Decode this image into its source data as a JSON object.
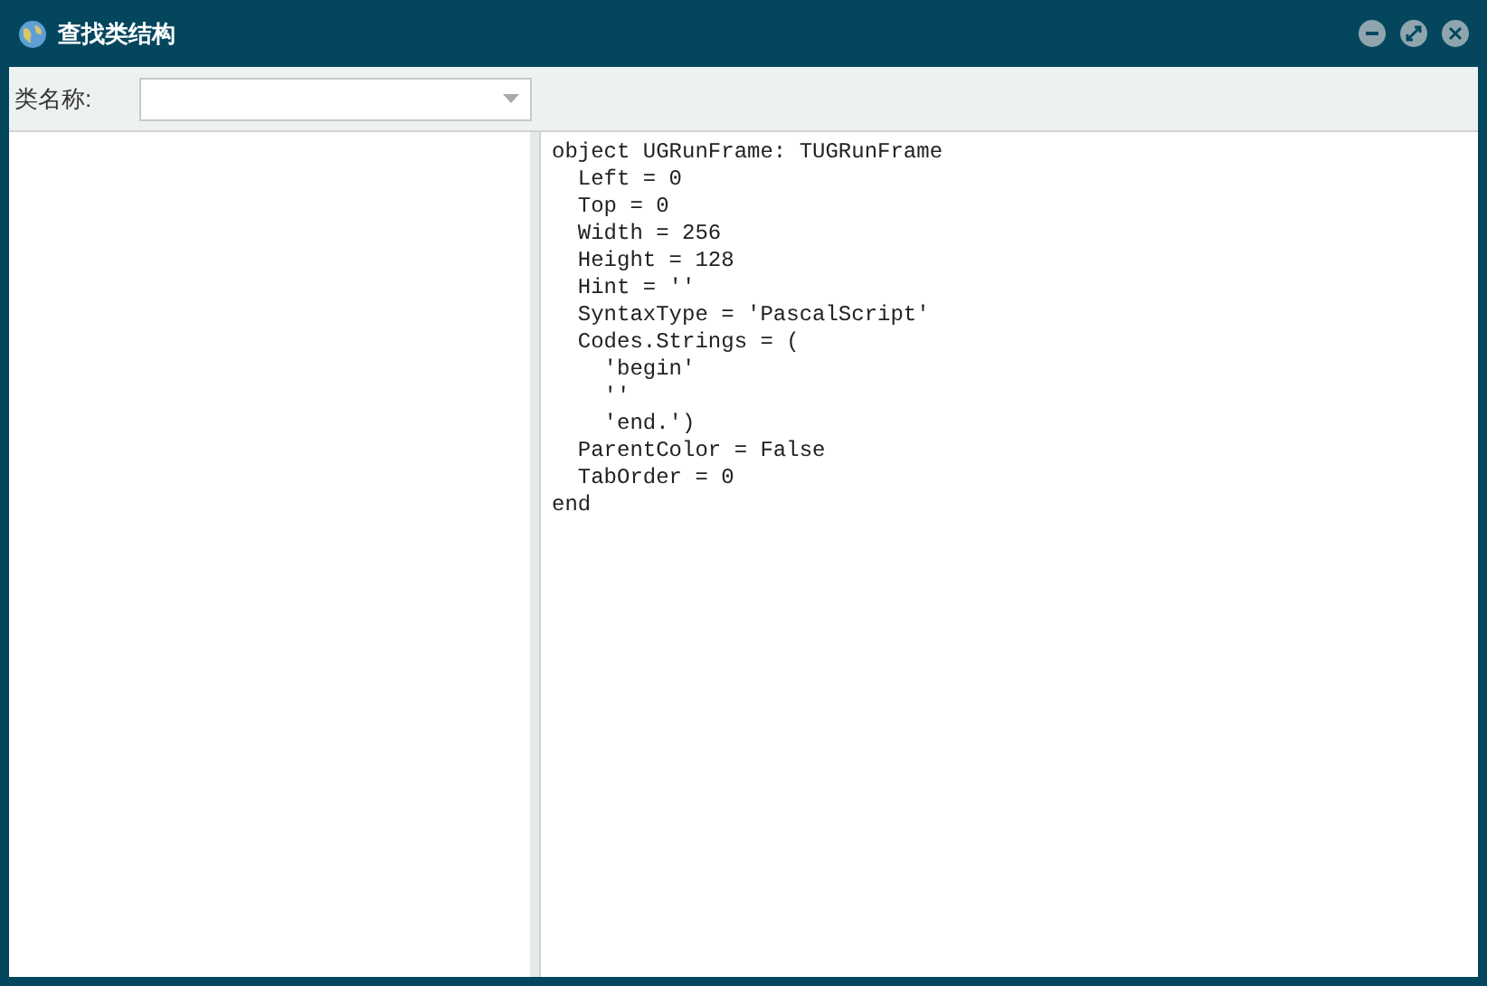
{
  "window": {
    "title": "查找类结构"
  },
  "class_name_field": {
    "label": "类名称:"
  },
  "code_lines": [
    "object UGRunFrame: TUGRunFrame",
    "  Left = 0",
    "  Top = 0",
    "  Width = 256",
    "  Height = 128",
    "  Hint = ''",
    "  SyntaxType = 'PascalScript'",
    "  Codes.Strings = (",
    "    'begin'",
    "    ''",
    "    'end.')",
    "  ParentColor = False",
    "  TabOrder = 0",
    "end"
  ]
}
